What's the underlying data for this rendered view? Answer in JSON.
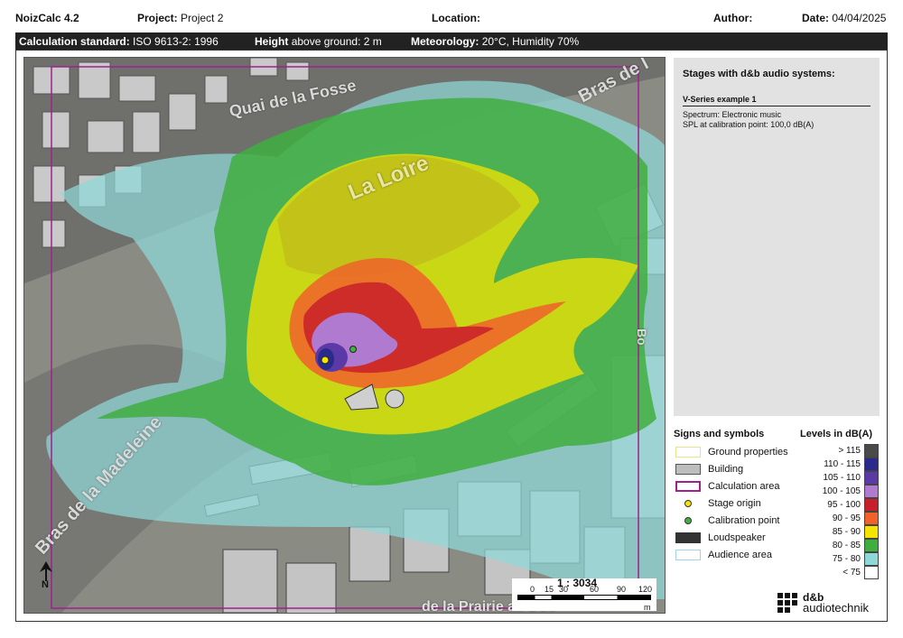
{
  "header": {
    "app": "NoizCalc 4.2",
    "project_label": "Project:",
    "project_value": "Project 2",
    "location_label": "Location:",
    "location_value": "",
    "author_label": "Author:",
    "author_value": "",
    "date_label": "Date:",
    "date_value": "04/04/2025"
  },
  "params": {
    "standard_label": "Calculation standard:",
    "standard_value": "ISO 9613-2: 1996",
    "height_label": "Height",
    "height_value": "above ground: 2 m",
    "meteo_label": "Meteorology:",
    "meteo_value": "20°C, Humidity 70%"
  },
  "map": {
    "labels": {
      "quai": "Quai de la Fosse",
      "loire": "La Loire",
      "madeleine": "Bras de la Madeleine",
      "bras_top": "Bras de l",
      "prairie": "de la Prairie au Duc",
      "bo": "Bo"
    },
    "scale_ratio": "1 : 3034",
    "scale_ticks": [
      "0",
      "15",
      "30",
      "60",
      "90",
      "120"
    ],
    "scale_unit": "m",
    "north_label": "N"
  },
  "info": {
    "title": "Stages with d&b audio systems:",
    "stage_name": "V-Series example 1",
    "spectrum": "Spectrum:  Electronic music",
    "spl": "SPL at calibration point:  100,0 dB(A)"
  },
  "symbols": {
    "title": "Signs and symbols",
    "items": [
      {
        "label": "Ground properties",
        "icon": "outline-box",
        "color": "#e8e48a"
      },
      {
        "label": "Building",
        "icon": "filled-box",
        "color": "#bdbdbd"
      },
      {
        "label": "Calculation area",
        "icon": "outline-box",
        "color": "#a0208f"
      },
      {
        "label": "Stage origin",
        "icon": "dot",
        "color": "#f4e400"
      },
      {
        "label": "Calibration point",
        "icon": "dot",
        "color": "#40b040"
      },
      {
        "label": "Loudspeaker",
        "icon": "filled-box",
        "color": "#333333"
      },
      {
        "label": "Audience area",
        "icon": "outline-box",
        "color": "#9ed4f0"
      }
    ]
  },
  "levels": {
    "title": "Levels in dB(A)",
    "items": [
      {
        "range": "> 115",
        "color": "#4a4a4a"
      },
      {
        "range": "110 -  115",
        "color": "#2a2a8c"
      },
      {
        "range": "105 -  110",
        "color": "#5b3aa8"
      },
      {
        "range": "100 -  105",
        "color": "#b07ad0"
      },
      {
        "range": "95 -  100",
        "color": "#c8202a"
      },
      {
        "range": "90 -  95",
        "color": "#f0622a"
      },
      {
        "range": "85 -  90",
        "color": "#f4e400"
      },
      {
        "range": "80 -  85",
        "color": "#3fae3f"
      },
      {
        "range": "75 -  80",
        "color": "#8fd8d8"
      },
      {
        "range": "< 75",
        "color": "#ffffff"
      }
    ]
  },
  "logo": {
    "brand": "d&b",
    "sub": "audiotechnik"
  }
}
